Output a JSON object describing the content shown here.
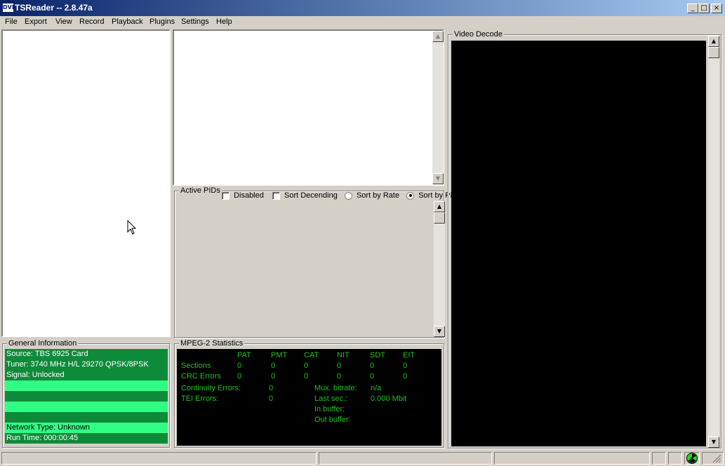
{
  "window": {
    "title": "TSReader -- 2.8.47a",
    "icon_text": "DVB",
    "min_glyph": "_",
    "max_glyph": "□",
    "close_glyph": "×"
  },
  "menu": [
    "File",
    "Export",
    "View",
    "Record",
    "Playback",
    "Plugins",
    "Settings",
    "Help"
  ],
  "pids": {
    "label": "Active PIDs",
    "disabled_label": "Disabled",
    "sort_desc_label": "Sort Decending",
    "sort_rate_label": "Sort by Rate",
    "sort_pid_label": "Sort by PID",
    "disabled_checked": false,
    "sort_desc_checked": false,
    "selected_sort": "Sort by PID"
  },
  "general": {
    "label": "General Information",
    "rows": [
      "Source: TBS 6925 Card",
      "Tuner:  3740 MHz H/L 29270 QPSK/8PSK",
      "Signal: Unlocked",
      "",
      "",
      "",
      "",
      "Network Type: Unknown",
      "Run Time: 000:00:45"
    ]
  },
  "mpeg": {
    "label": "MPEG-2 Statistics",
    "headers": [
      "PAT",
      "PMT",
      "CAT",
      "NIT",
      "SDT",
      "EIT"
    ],
    "sections_label": "Sections",
    "sections": [
      "0",
      "0",
      "0",
      "0",
      "0",
      "0"
    ],
    "crc_label": "CRC Errors",
    "crc": [
      "0",
      "0",
      "0",
      "0",
      "0",
      "0"
    ],
    "cont_label": "Continuity Errors:",
    "cont_value": "0",
    "tei_label": "TEI Errors:",
    "tei_value": "0",
    "mux_label": "Mux. bitrate:",
    "mux_value": "n/a",
    "last_label": "Last sec.:",
    "last_value": "0.000 Mbit",
    "inbuf_label": "In buffer:",
    "outbuf_label": "Out buffer:"
  },
  "video": {
    "label": "Video Decode"
  },
  "scroll": {
    "up": "▲",
    "down": "▼"
  },
  "status_icon": "radiation-icon"
}
